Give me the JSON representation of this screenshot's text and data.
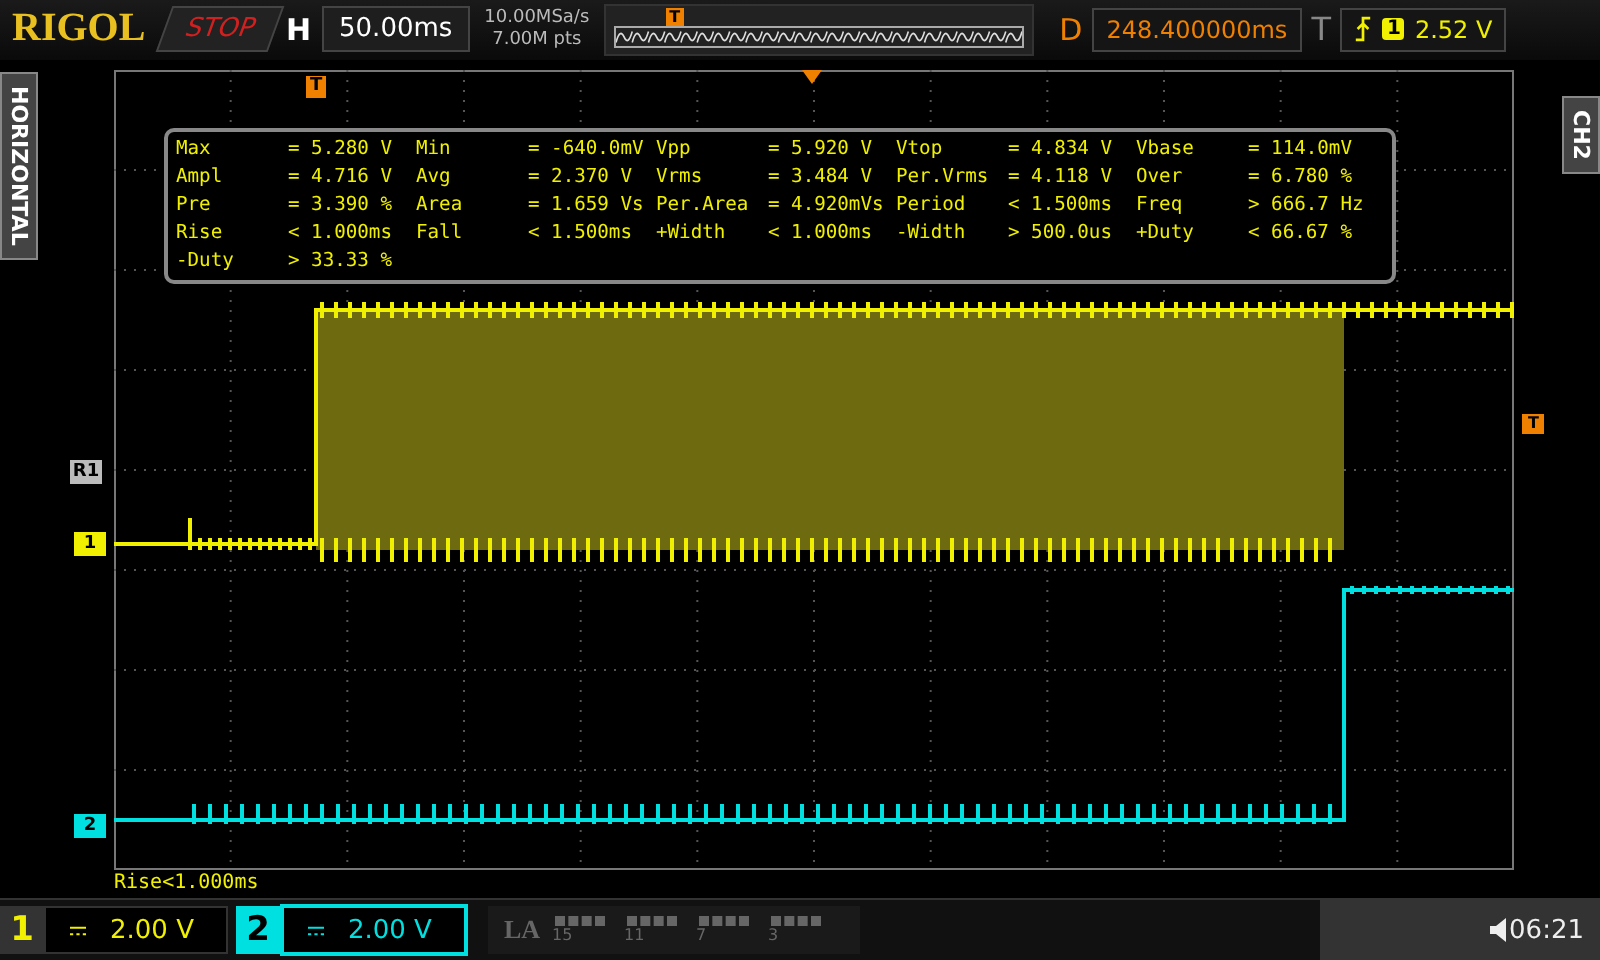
{
  "top_bar": {
    "logo": "RIGOL",
    "run_state": "STOP",
    "horizontal_label": "H",
    "timebase": "50.00ms",
    "sample_rate": "10.00MSa/s",
    "memory_depth": "7.00M pts",
    "memory_trigger_marker": "T",
    "delay_label": "D",
    "delay": "248.400000ms",
    "trigger_label": "T",
    "trigger_source": "1",
    "trigger_level": "2.52 V"
  },
  "left_tab": "HORIZONTAL",
  "right_tab": "CH2",
  "plot": {
    "trigger_position_marker": "T",
    "trigger_level_marker": "T",
    "markers": [
      {
        "text": "R1",
        "kind": "reference"
      },
      {
        "text": "1",
        "kind": "channel",
        "color": "#f0f000"
      },
      {
        "text": "2",
        "kind": "channel",
        "color": "#00e0e0"
      }
    ],
    "measurements": [
      {
        "label": "Max",
        "value": "= 5.280 V"
      },
      {
        "label": "Min",
        "value": "= -640.0mV"
      },
      {
        "label": "Vpp",
        "value": "= 5.920 V"
      },
      {
        "label": "Vtop",
        "value": "= 4.834 V"
      },
      {
        "label": "Vbase",
        "value": "= 114.0mV"
      },
      {
        "label": "Ampl",
        "value": "= 4.716 V"
      },
      {
        "label": "Avg",
        "value": "= 2.370 V"
      },
      {
        "label": "Vrms",
        "value": "= 3.484 V"
      },
      {
        "label": "Per.Vrms",
        "value": "= 4.118 V"
      },
      {
        "label": "Over",
        "value": "= 6.780 %"
      },
      {
        "label": "Pre",
        "value": "= 3.390 %"
      },
      {
        "label": "Area",
        "value": "= 1.659 Vs"
      },
      {
        "label": "Per.Area",
        "value": "= 4.920mVs"
      },
      {
        "label": "Period",
        "value": "< 1.500ms"
      },
      {
        "label": "Freq",
        "value": "> 666.7 Hz"
      },
      {
        "label": "Rise",
        "value": "< 1.000ms"
      },
      {
        "label": "Fall",
        "value": "< 1.500ms"
      },
      {
        "label": "+Width",
        "value": "< 1.000ms"
      },
      {
        "label": "-Width",
        "value": "> 500.0us"
      },
      {
        "label": "+Duty",
        "value": "< 66.67 %"
      },
      {
        "label": "-Duty",
        "value": "> 33.33 %"
      }
    ],
    "footer_measurement": "Rise<1.000ms"
  },
  "channels": [
    {
      "label": "1",
      "scale": "2.00 V",
      "selected": false,
      "color": "#f0f000"
    },
    {
      "label": "2",
      "scale": "2.00 V",
      "selected": true,
      "color": "#00e0e0"
    }
  ],
  "la": {
    "label": "LA",
    "numbers": [
      "15",
      "11",
      "7",
      "3"
    ]
  },
  "clock": "06:21"
}
